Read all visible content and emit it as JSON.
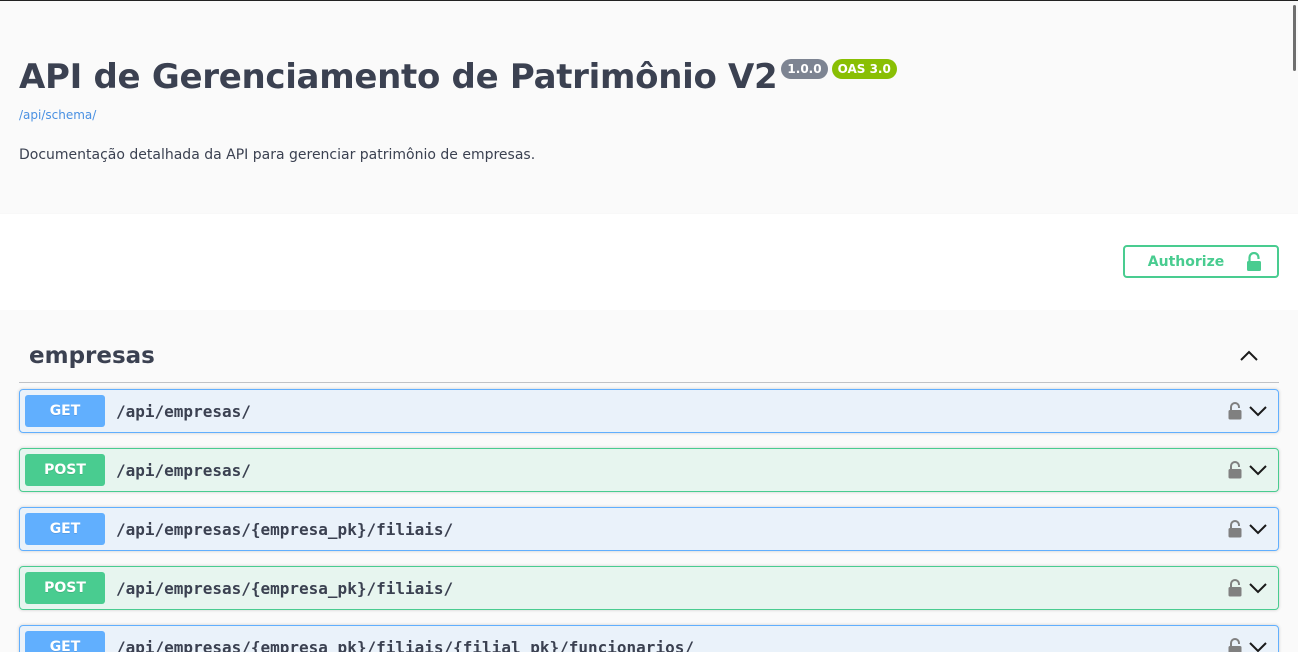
{
  "info": {
    "title": "API de Gerenciamento de Patrimônio V2",
    "version": "1.0.0",
    "oas": "OAS 3.0",
    "schema_link": "/api/schema/",
    "description": "Documentação detalhada da API para gerenciar patrimônio de empresas."
  },
  "auth": {
    "authorize_label": "Authorize"
  },
  "tag": {
    "name": "empresas"
  },
  "operations": [
    {
      "method": "GET",
      "path": "/api/empresas/"
    },
    {
      "method": "POST",
      "path": "/api/empresas/"
    },
    {
      "method": "GET",
      "path": "/api/empresas/{empresa_pk}/filiais/"
    },
    {
      "method": "POST",
      "path": "/api/empresas/{empresa_pk}/filiais/"
    },
    {
      "method": "GET",
      "path": "/api/empresas/{empresa_pk}/filiais/{filial_pk}/funcionarios/"
    }
  ],
  "colors": {
    "get": "#61affe",
    "post": "#49cc90",
    "version_badge": "#7d8492",
    "oas_badge": "#89bf04",
    "link": "#4990e2"
  },
  "icons": {
    "lock": "lock-icon",
    "chevron_down": "chevron-down-icon",
    "chevron_up": "chevron-up-icon"
  }
}
